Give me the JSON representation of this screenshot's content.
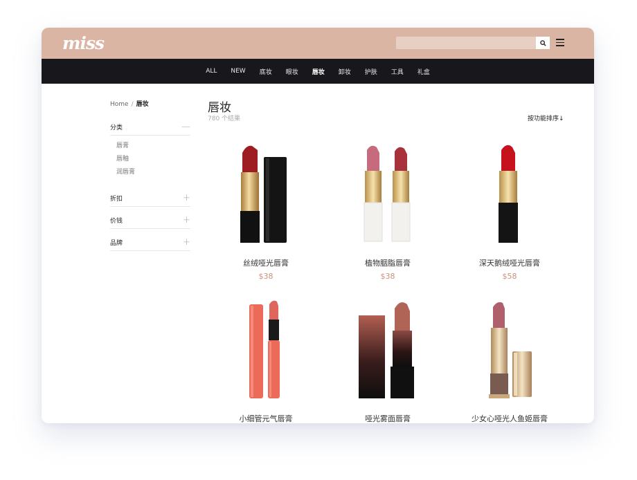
{
  "header": {
    "logo": "miss",
    "search_placeholder": ""
  },
  "nav": {
    "items": [
      "ALL",
      "NEW",
      "底妆",
      "眼妆",
      "唇妆",
      "卸妆",
      "护肤",
      "工具",
      "礼盒"
    ],
    "active": "唇妆"
  },
  "breadcrumb": {
    "home": "Home",
    "sep": "/",
    "current": "唇妆"
  },
  "sidebar": {
    "category": {
      "title": "分类",
      "items": [
        "唇膏",
        "唇釉",
        "润唇膏"
      ]
    },
    "discount": {
      "title": "折扣"
    },
    "price": {
      "title": "价钱"
    },
    "brand": {
      "title": "品牌"
    }
  },
  "main": {
    "title": "唇妆",
    "result_count": "780 个结果",
    "sort_label": "按功能排序↓"
  },
  "products": [
    {
      "name": "丝绒哑光唇膏",
      "price": "$38"
    },
    {
      "name": "植物胭脂唇膏",
      "price": "$38"
    },
    {
      "name": "深天鹅绒哑光唇膏",
      "price": "$58"
    },
    {
      "name": "小细管元气唇膏",
      "price": ""
    },
    {
      "name": "哑光雾面唇膏",
      "price": ""
    },
    {
      "name": "少女心哑光人鱼姬唇膏",
      "price": ""
    }
  ],
  "colors": {
    "header_bg": "#dbb5a4",
    "nav_bg": "#18181c",
    "price": "#c8917c"
  }
}
